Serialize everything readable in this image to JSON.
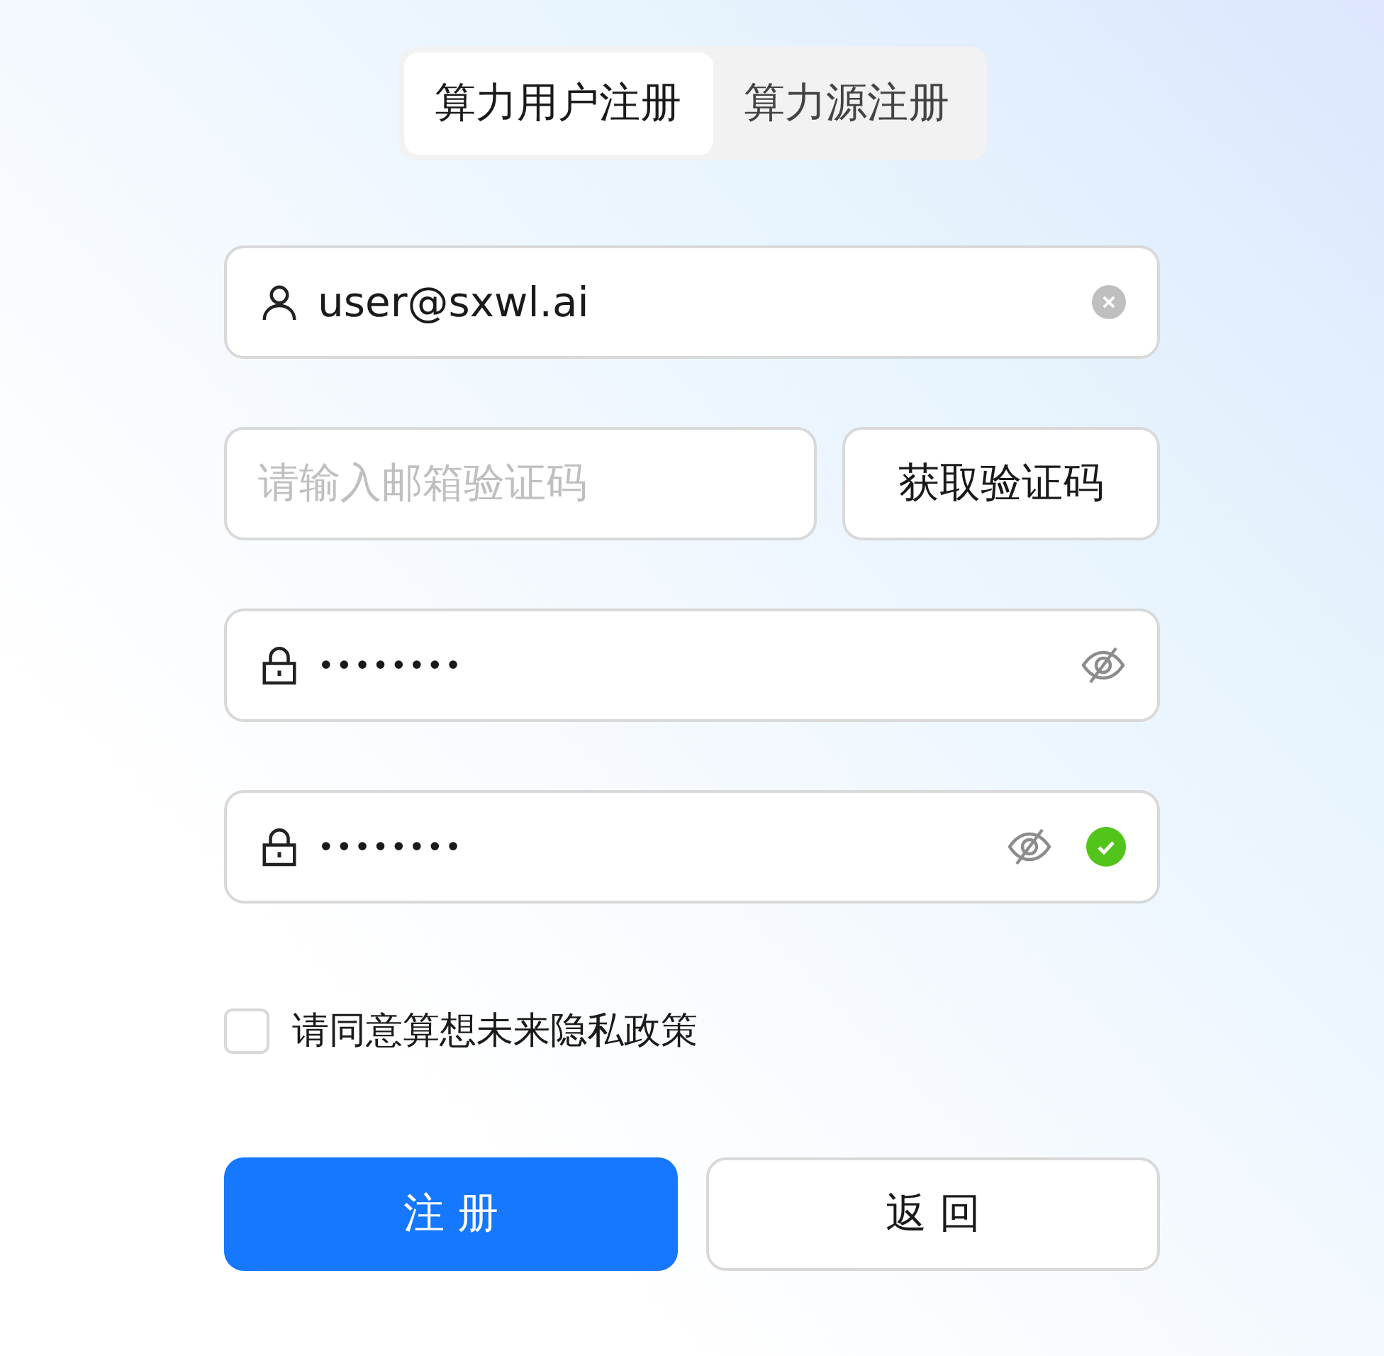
{
  "tabs": [
    {
      "label": "算力用户注册",
      "selected": true
    },
    {
      "label": "算力源注册",
      "selected": false
    }
  ],
  "email": {
    "value": "user@sxwl.ai",
    "clearable": true
  },
  "code": {
    "placeholder": "请输入邮箱验证码",
    "button": "获取验证码"
  },
  "passwords": [
    {
      "value": "••••••••",
      "valid": false
    },
    {
      "value": "••••••••",
      "valid": true
    }
  ],
  "agreement": {
    "label": "请同意算想未来隐私政策",
    "checked": false
  },
  "buttons": [
    {
      "label": "注 册",
      "kind": "primary"
    },
    {
      "label": "返 回",
      "kind": "default"
    }
  ]
}
